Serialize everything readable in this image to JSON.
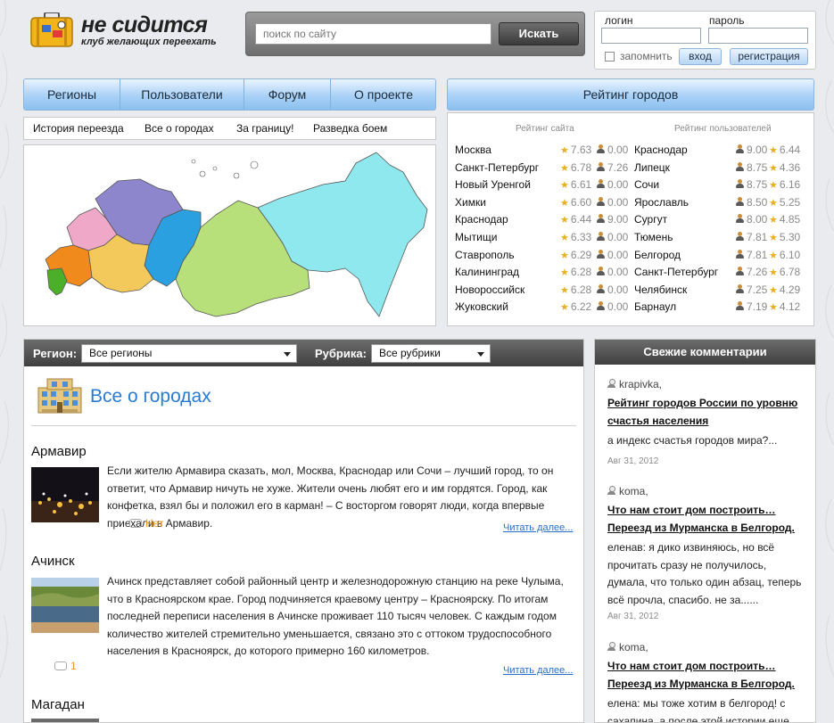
{
  "logo": {
    "title": "не сидится",
    "tagline": "клуб желающих переехать"
  },
  "search": {
    "placeholder": "поиск по сайту",
    "button": "Искать"
  },
  "login": {
    "login_label": "логин",
    "password_label": "пароль",
    "remember": "запомнить",
    "login_button": "вход",
    "register_button": "регистрация"
  },
  "nav": {
    "items": [
      "Регионы",
      "Пользователи",
      "Форум",
      "О проекте"
    ]
  },
  "subnav": {
    "items": [
      "История переезда",
      "Все о городах",
      "За границу!",
      "Разведка боем"
    ]
  },
  "rating": {
    "title": "Рейтинг городов",
    "site_header": "Рейтинг сайта",
    "users_header": "Рейтинг пользователей",
    "site": [
      {
        "city": "Москва",
        "a": "7.63",
        "b": "0.00"
      },
      {
        "city": "Санкт-Петербург",
        "a": "6.78",
        "b": "7.26"
      },
      {
        "city": "Новый Уренгой",
        "a": "6.61",
        "b": "0.00"
      },
      {
        "city": "Химки",
        "a": "6.60",
        "b": "0.00"
      },
      {
        "city": "Краснодар",
        "a": "6.44",
        "b": "9.00"
      },
      {
        "city": "Мытищи",
        "a": "6.33",
        "b": "0.00"
      },
      {
        "city": "Ставрополь",
        "a": "6.29",
        "b": "0.00"
      },
      {
        "city": "Калининград",
        "a": "6.28",
        "b": "0.00"
      },
      {
        "city": "Новороссийск",
        "a": "6.28",
        "b": "0.00"
      },
      {
        "city": "Жуковский",
        "a": "6.22",
        "b": "0.00"
      }
    ],
    "users": [
      {
        "city": "Краснодар",
        "a": "9.00",
        "b": "6.44"
      },
      {
        "city": "Липецк",
        "a": "8.75",
        "b": "4.36"
      },
      {
        "city": "Сочи",
        "a": "8.75",
        "b": "6.16"
      },
      {
        "city": "Ярославль",
        "a": "8.50",
        "b": "5.25"
      },
      {
        "city": "Сургут",
        "a": "8.00",
        "b": "4.85"
      },
      {
        "city": "Тюмень",
        "a": "7.81",
        "b": "5.30"
      },
      {
        "city": "Белгород",
        "a": "7.81",
        "b": "6.10"
      },
      {
        "city": "Санкт-Петербург",
        "a": "7.26",
        "b": "6.78"
      },
      {
        "city": "Челябинск",
        "a": "7.25",
        "b": "4.29"
      },
      {
        "city": "Барнаул",
        "a": "7.19",
        "b": "4.12"
      }
    ]
  },
  "filters": {
    "region_label": "Регион:",
    "region_value": "Все регионы",
    "rubric_label": "Рубрика:",
    "rubric_value": "Все рубрики"
  },
  "main": {
    "title": "Все о городах",
    "read_more": "Читать далее...",
    "articles": [
      {
        "city": "Армавир",
        "text": "Если жителю Армавира сказать, мол, Москва, Краснодар или Сочи – лучший город, то он ответит, что Армавир ничуть не хуже. Жители очень любят его и им гордятся. Город, как конфетка, взял бы и положил его в карман! – С восторгом говорят люди, когда впервые приехали в Армавир.",
        "comments": "Нет"
      },
      {
        "city": "Ачинск",
        "text": "Ачинск представляет собой районный центр и железнодорожную станцию на реке Чулыма, что в Красноярском крае. Город подчиняется краевому центру – Красноярску. По итогам последней переписи населения в Ачинске проживает 110 тысяч человек. С каждым годом количество жителей стремительно уменьшается, связано это с оттоком трудоспособного населения в Красноярск, до которого примерно 160 километров.",
        "comments": "1"
      },
      {
        "city": "Магадан",
        "text": "",
        "comments": ""
      }
    ]
  },
  "sidebar": {
    "title": "Свежие комментарии",
    "comments": [
      {
        "user": "krapivka,",
        "title": "Рейтинг городов России по уровню счастья населения",
        "text": "а индекс счастья городов мира?...",
        "date": "Авг 31, 2012"
      },
      {
        "user": "koma,",
        "title": "Что нам стоит дом построить… Переезд из Мурманска в Белгород.",
        "text": "еленав: я дико извиняюсь, но всё прочитать сразу не получилось, думала, что только один абзац, теперь всё прочла, спасибо. не за......",
        "date": "Авг 31, 2012"
      },
      {
        "user": "koma,",
        "title": "Что нам стоит дом построить… Переезд из Мурманска в Белгород.",
        "text": "елена: мы тоже хотим в белгород! с сахапина, а после этой истории еще",
        "date": ""
      }
    ]
  },
  "colors": {
    "accent_blue": "#2a7bd0",
    "nav_gradient_top": "#e9f4ff",
    "nav_gradient_bottom": "#8cc0ef",
    "dark_bar": "#4a4a4a",
    "comments_orange": "#e49b2a"
  },
  "map_regions": [
    {
      "name": "south",
      "color": "#4caf2a"
    },
    {
      "name": "north-caucasus",
      "color": "#f08a1c"
    },
    {
      "name": "central",
      "color": "#f2c95a"
    },
    {
      "name": "north-west",
      "color": "#8d86cc"
    },
    {
      "name": "volga",
      "color": "#f0a8c8"
    },
    {
      "name": "ural",
      "color": "#2aa0e0"
    },
    {
      "name": "siberia",
      "color": "#b8e07a"
    },
    {
      "name": "far-east",
      "color": "#8fe8ee"
    }
  ]
}
